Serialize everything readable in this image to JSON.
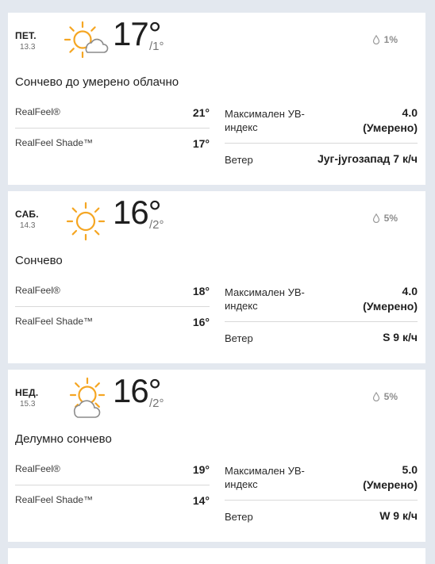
{
  "days": [
    {
      "dow": "ПЕТ.",
      "date": "13.3",
      "icon": "sun-cloud-icon",
      "temp": "17°",
      "low": "/1°",
      "precip": "1%",
      "phrase": "Сончево до умерено облачно",
      "realfeel_label": "RealFeel®",
      "realfeel": "21°",
      "shade_label": "RealFeel Shade™",
      "shade": "17°",
      "uv_label": "Максимален УВ-индекс",
      "uv_value": "4.0",
      "uv_desc": "(Умерено)",
      "wind_label": "Ветер",
      "wind": "Југ-југозапад 7 к/ч"
    },
    {
      "dow": "САБ.",
      "date": "14.3",
      "icon": "sun-icon",
      "temp": "16°",
      "low": "/2°",
      "precip": "5%",
      "phrase": "Сончево",
      "realfeel_label": "RealFeel®",
      "realfeel": "18°",
      "shade_label": "RealFeel Shade™",
      "shade": "16°",
      "uv_label": "Максимален УВ-индекс",
      "uv_value": "4.0",
      "uv_desc": "(Умерено)",
      "wind_label": "Ветер",
      "wind": "S 9 к/ч"
    },
    {
      "dow": "НЕД.",
      "date": "15.3",
      "icon": "partly-sunny-icon",
      "temp": "16°",
      "low": "/2°",
      "precip": "5%",
      "phrase": "Делумно сончево",
      "realfeel_label": "RealFeel®",
      "realfeel": "19°",
      "shade_label": "RealFeel Shade™",
      "shade": "14°",
      "uv_label": "Максимален УВ-индекс",
      "uv_value": "5.0",
      "uv_desc": "(Умерено)",
      "wind_label": "Ветер",
      "wind": "W 9 к/ч"
    }
  ],
  "colors": {
    "sun": "#f5a623",
    "cloud_stroke": "#8c8c8c",
    "page_bg": "#e3e8ef"
  }
}
